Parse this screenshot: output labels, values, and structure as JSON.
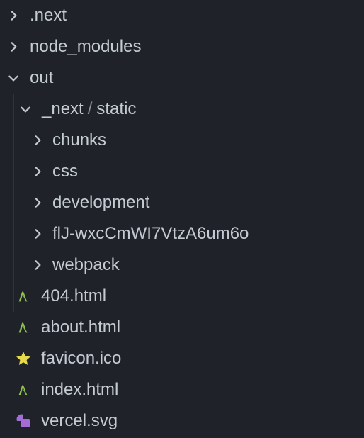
{
  "explorer": {
    "items": [
      {
        "label": ".next",
        "type": "folder",
        "expanded": false,
        "depth": 0
      },
      {
        "label": "node_modules",
        "type": "folder",
        "expanded": false,
        "depth": 0
      },
      {
        "label": "out",
        "type": "folder",
        "expanded": true,
        "depth": 0
      },
      {
        "label_part1": "_next",
        "separator": "/",
        "label_part2": "static",
        "type": "folder",
        "expanded": true,
        "depth": 1
      },
      {
        "label": "chunks",
        "type": "folder",
        "expanded": false,
        "depth": 2
      },
      {
        "label": "css",
        "type": "folder",
        "expanded": false,
        "depth": 2
      },
      {
        "label": "development",
        "type": "folder",
        "expanded": false,
        "depth": 2
      },
      {
        "label": "flJ-wxcCmWI7VtzA6um6o",
        "type": "folder",
        "expanded": false,
        "depth": 2
      },
      {
        "label": "webpack",
        "type": "folder",
        "expanded": false,
        "depth": 2
      },
      {
        "label": "404.html",
        "type": "file",
        "icon": "html-icon",
        "depth": 1
      },
      {
        "label": "about.html",
        "type": "file",
        "icon": "html-icon",
        "depth": 1
      },
      {
        "label": "favicon.ico",
        "type": "file",
        "icon": "star-icon",
        "depth": 1
      },
      {
        "label": "index.html",
        "type": "file",
        "icon": "html-icon",
        "depth": 1
      },
      {
        "label": "vercel.svg",
        "type": "file",
        "icon": "svg-icon",
        "depth": 1
      }
    ]
  },
  "colors": {
    "background": "#1f2329",
    "text": "#c5cbd3",
    "html_icon": "#8fc24a",
    "star_icon": "#e6d94a",
    "svg_icon": "#a36cd6"
  }
}
